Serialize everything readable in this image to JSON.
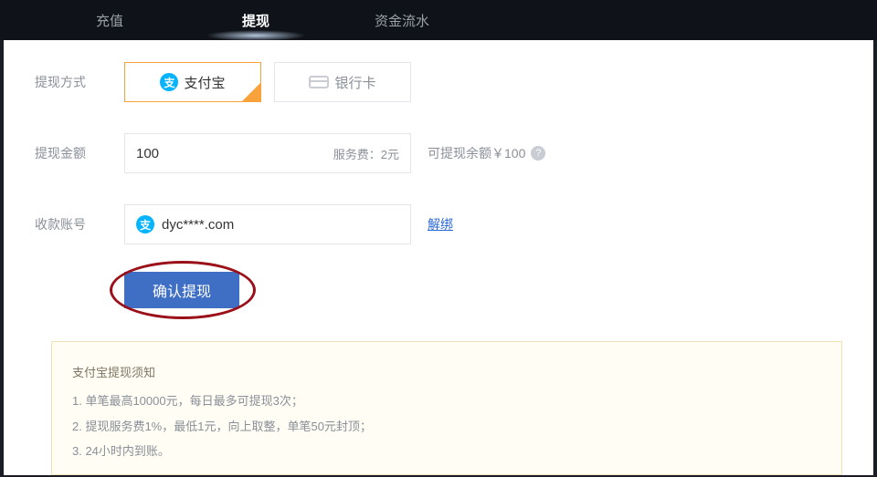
{
  "tabs": {
    "recharge": "充值",
    "withdraw": "提现",
    "flow": "资金流水"
  },
  "labels": {
    "method": "提现方式",
    "amount": "提现金额",
    "account": "收款账号"
  },
  "methods": {
    "alipay": "支付宝",
    "bankcard": "银行卡",
    "alipay_glyph": "支"
  },
  "amount": {
    "value": "100",
    "fee_text": "服务费：2元",
    "balance_text": "可提现余额￥100",
    "help_glyph": "?"
  },
  "account": {
    "value": "dyc****.com",
    "unbind": "解绑"
  },
  "submit": "确认提现",
  "notice": {
    "title": "支付宝提现须知",
    "line1": "1. 单笔最高10000元，每日最多可提现3次；",
    "line2": "2. 提现服务费1%，最低1元，向上取整，单笔50元封顶；",
    "line3": "3. 24小时内到账。"
  }
}
